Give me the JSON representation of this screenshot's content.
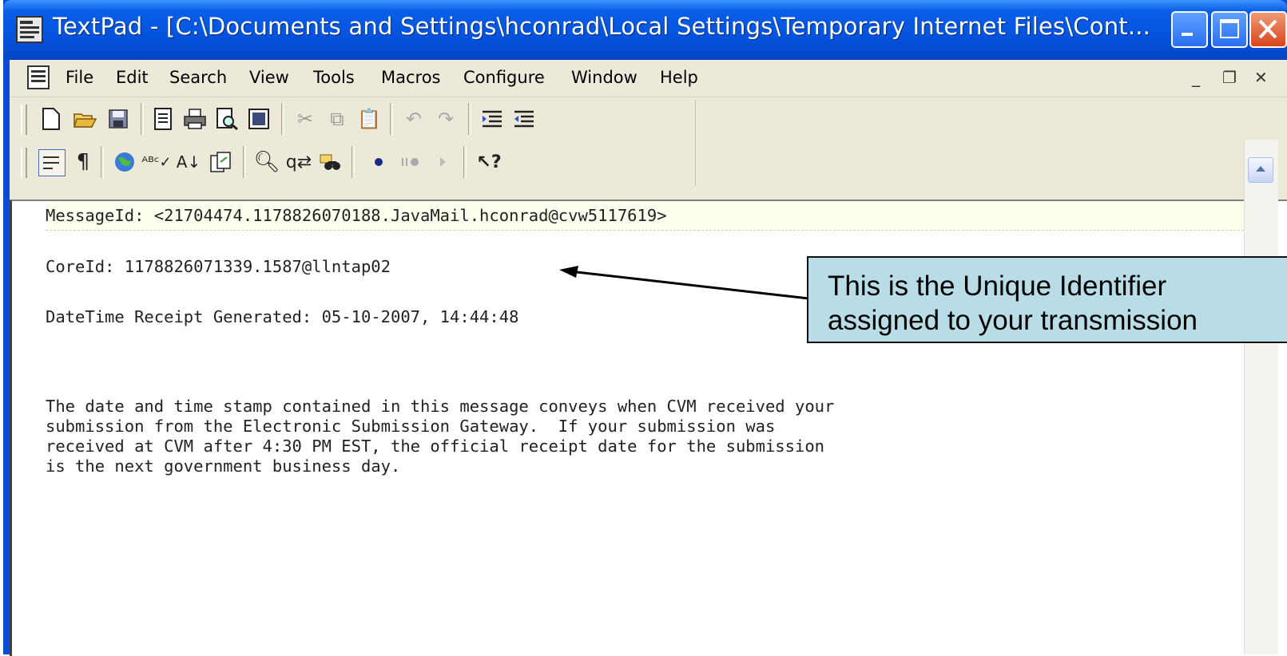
{
  "window": {
    "title": "TextPad - [C:\\Documents and Settings\\hconrad\\Local Settings\\Temporary Internet Files\\Cont..."
  },
  "menu": {
    "items": [
      {
        "label": "File"
      },
      {
        "label": "Edit"
      },
      {
        "label": "Search"
      },
      {
        "label": "View"
      },
      {
        "label": "Tools"
      },
      {
        "label": "Macros"
      },
      {
        "label": "Configure"
      },
      {
        "label": "Window"
      },
      {
        "label": "Help"
      }
    ]
  },
  "toolbar1_icons": [
    "new-icon",
    "open-icon",
    "save-icon",
    "document-properties-icon",
    "print-icon",
    "print-preview-icon",
    "view-icon",
    "cut-icon",
    "copy-icon",
    "paste-icon",
    "undo-icon",
    "redo-icon",
    "indent-icon",
    "outdent-icon"
  ],
  "toolbar2_icons": [
    "word-wrap-icon",
    "pilcrow-icon",
    "web-icon",
    "spell-check-icon",
    "sort-icon",
    "compare-icon",
    "find-icon",
    "replace-icon",
    "find-in-files-icon",
    "record-macro-icon",
    "pause-macro-icon",
    "play-macro-icon",
    "help-pointer-icon"
  ],
  "editor": {
    "lines": [
      "MessageId: <21704474.1178826070188.JavaMail.hconrad@cvw5117619>",
      "CoreId: 1178826071339.1587@llntap02",
      "DateTime Receipt Generated: 05-10-2007, 14:44:48",
      "The date and time stamp contained in this message conveys when CVM received your",
      "submission from the Electronic Submission Gateway.  If your submission was",
      "received at CVM after 4:30 PM EST, the official receipt date for the submission",
      "is the next government business day."
    ]
  },
  "callout": {
    "line1": "This is the Unique Identifier",
    "line2": "assigned to your transmission"
  },
  "colors": {
    "titlebar": "#0453dd",
    "chrome": "#ece9d8",
    "callout_bg": "#b9dde6"
  }
}
